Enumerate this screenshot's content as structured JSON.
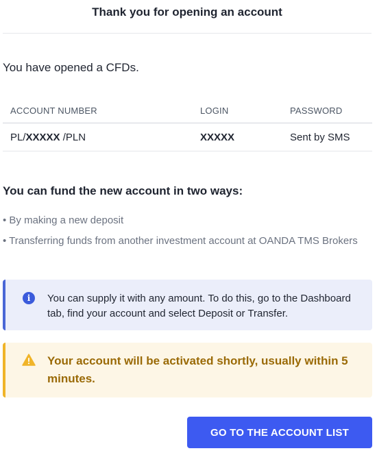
{
  "header": {
    "title": "Thank you for opening an account"
  },
  "intro": {
    "text": "You have opened a CFDs."
  },
  "account_table": {
    "columns": [
      "ACCOUNT NUMBER",
      "LOGIN",
      "PASSWORD"
    ],
    "row": {
      "account_prefix": "PL/",
      "account_masked": "XXXXX",
      "account_suffix": " /PLN",
      "login": "XXXXX",
      "password": "Sent by SMS"
    }
  },
  "funding": {
    "heading": "You can fund the new account in two ways:",
    "items": [
      "• By making a new deposit",
      "• Transferring funds from another investment account at OANDA TMS Brokers"
    ]
  },
  "info_notice": {
    "icon": "info-icon",
    "icon_glyph": "i",
    "text": "You can supply it with any amount. To do this, go to the Dashboard tab, find your account and select Deposit or Transfer.",
    "accent_color": "#4a67d6"
  },
  "warning_notice": {
    "icon": "warning-icon",
    "text": "Your account will be activated shortly, usually within 5 minutes.",
    "accent_color": "#f0b429"
  },
  "cta": {
    "label": "GO TO THE ACCOUNT LIST",
    "color": "#3d5af1"
  }
}
